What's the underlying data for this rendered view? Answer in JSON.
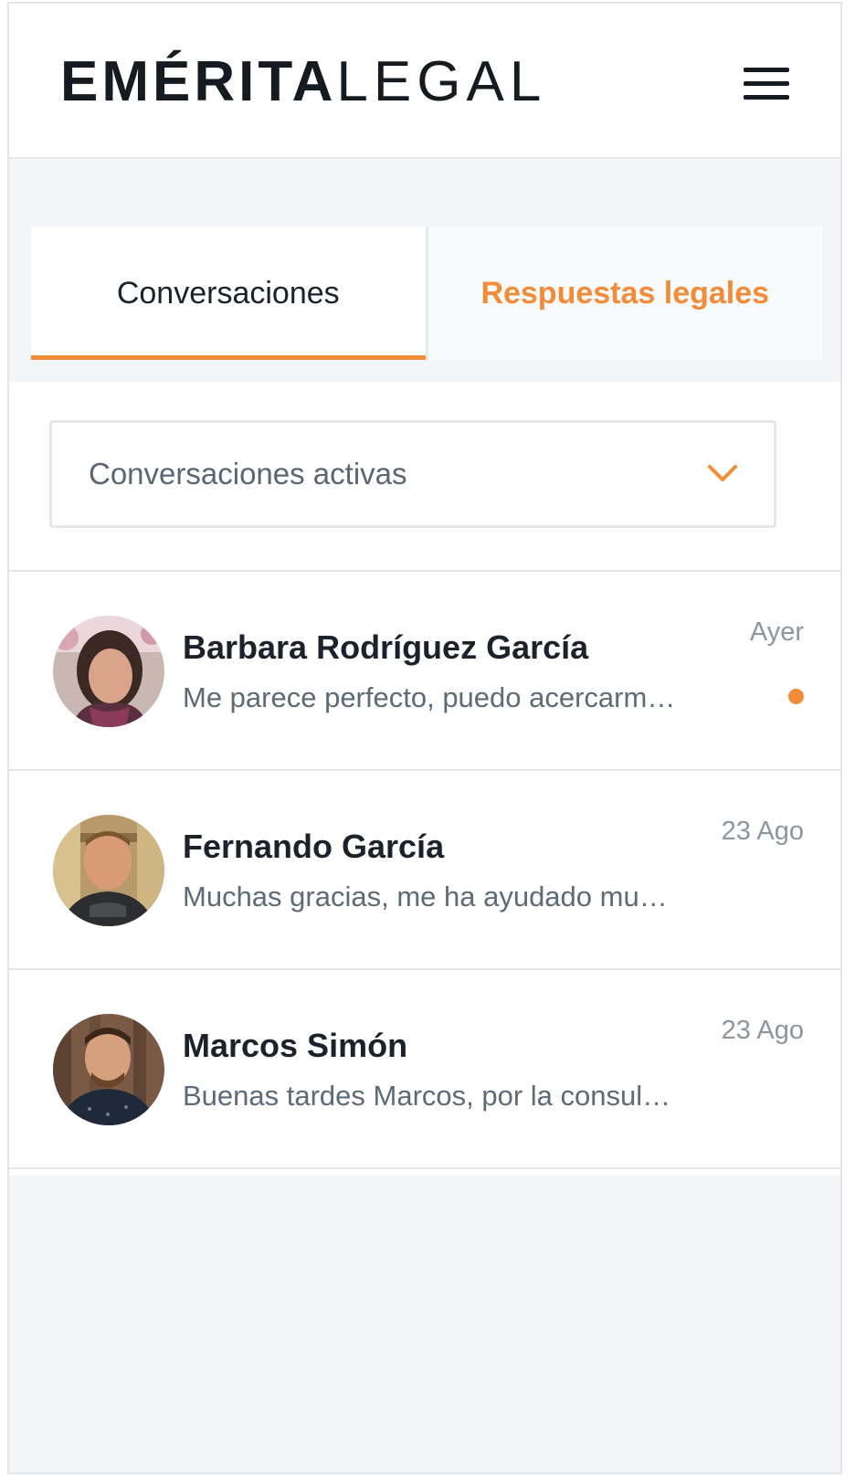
{
  "header": {
    "logo_bold_part1": "EM",
    "logo_bold_accent": "É",
    "logo_bold_part2": "RITA",
    "logo_light": "LEGAL",
    "menu_icon": "hamburger-menu-icon"
  },
  "tabs": [
    {
      "label": "Conversaciones",
      "active": true
    },
    {
      "label": "Respuestas legales",
      "active": false
    }
  ],
  "filter": {
    "selected": "Conversaciones activas",
    "icon": "chevron-down-icon"
  },
  "conversations": [
    {
      "name": "Barbara Rodríguez García",
      "preview": "Me parece perfecto, puedo acercarme…",
      "date": "Ayer",
      "unread": true
    },
    {
      "name": "Fernando García",
      "preview": "Muchas gracias, me ha ayudado mucho…",
      "date": "23 Ago",
      "unread": false
    },
    {
      "name": "Marcos Simón",
      "preview": "Buenas tardes Marcos, por la consulta…",
      "date": "23 Ago",
      "unread": false
    }
  ],
  "colors": {
    "accent": "#f28c38",
    "text_dark": "#1c222b",
    "text_muted": "#5e6a76",
    "background": "#f4f5f7"
  }
}
